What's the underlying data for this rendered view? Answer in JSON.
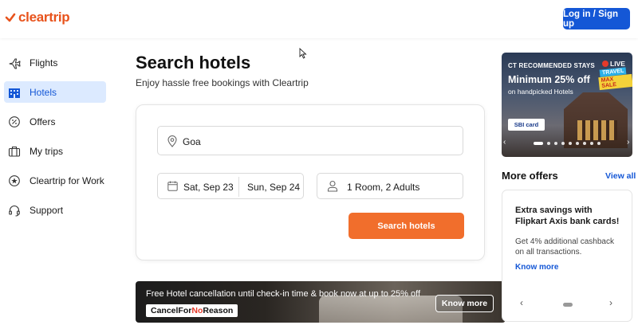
{
  "header": {
    "logo_text": "cleartrip",
    "login_label": "Log in / Sign up"
  },
  "sidebar": {
    "items": [
      {
        "label": "Flights",
        "icon": "plane-icon",
        "active": false
      },
      {
        "label": "Hotels",
        "icon": "building-icon",
        "active": true
      },
      {
        "label": "Offers",
        "icon": "offer-tag-icon",
        "active": false
      },
      {
        "label": "My trips",
        "icon": "suitcase-icon",
        "active": false
      },
      {
        "label": "Cleartrip for Work",
        "icon": "star-badge-icon",
        "active": false
      },
      {
        "label": "Support",
        "icon": "headset-icon",
        "active": false
      }
    ]
  },
  "main": {
    "title": "Search hotels",
    "subtitle": "Enjoy hassle free bookings with Cleartrip",
    "location_value": "Goa",
    "checkin": "Sat, Sep 23",
    "checkout": "Sun, Sep 24",
    "rooms_guests": "1 Room, 2 Adults",
    "search_button": "Search hotels"
  },
  "banner": {
    "text": "Free Hotel cancellation until check-in time & book now at up to 25% off",
    "tag_prefix": "CancelFor",
    "tag_no": "No",
    "tag_suffix": "Reason",
    "button": "Know more"
  },
  "promo": {
    "eyebrow": "CT RECOMMENDED STAYS",
    "headline": "Minimum 25% off",
    "sub": "on handpicked Hotels",
    "live": "LIVE",
    "travel": "TRAVEL",
    "sale": "MAX SALE",
    "card_brand": "SBI card",
    "prev": "‹",
    "next": "›",
    "slide_count": 9,
    "active_slide": 1
  },
  "offers": {
    "title": "More offers",
    "view_all": "View all",
    "card": {
      "headline": "Extra savings with Flipkart Axis bank cards!",
      "body": "Get 4% additional cashback on all transactions.",
      "link": "Know more"
    },
    "prev": "‹",
    "next": "›"
  },
  "colors": {
    "brand_orange": "#e8531c",
    "button_orange": "#f16e2c",
    "primary_blue": "#1457d6",
    "active_bg": "#dceaff"
  }
}
